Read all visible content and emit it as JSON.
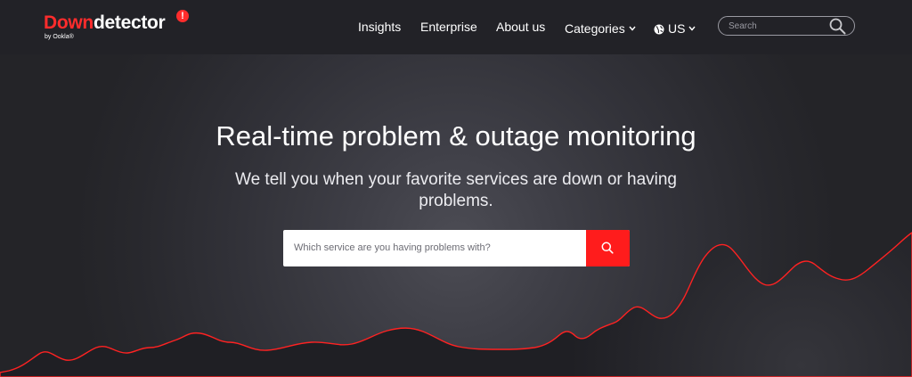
{
  "brand": {
    "name_part1": "Down",
    "name_part2": "detector",
    "badge": "!",
    "byline": "by Ookla®"
  },
  "nav": {
    "insights": "Insights",
    "enterprise": "Enterprise",
    "about": "About us",
    "categories": "Categories",
    "region": "US"
  },
  "header_search": {
    "placeholder": "Search"
  },
  "hero": {
    "title": "Real-time problem & outage monitoring",
    "subtitle": "We tell you when your favorite services are down or having problems.",
    "search_placeholder": "Which service are you having problems with?"
  },
  "colors": {
    "brand_red": "#ff2c2c",
    "button_red": "#ff1c1c",
    "background": "#222227"
  },
  "icons": {
    "search": "search-icon",
    "globe": "globe-icon",
    "chevron": "chevron-down-icon"
  }
}
